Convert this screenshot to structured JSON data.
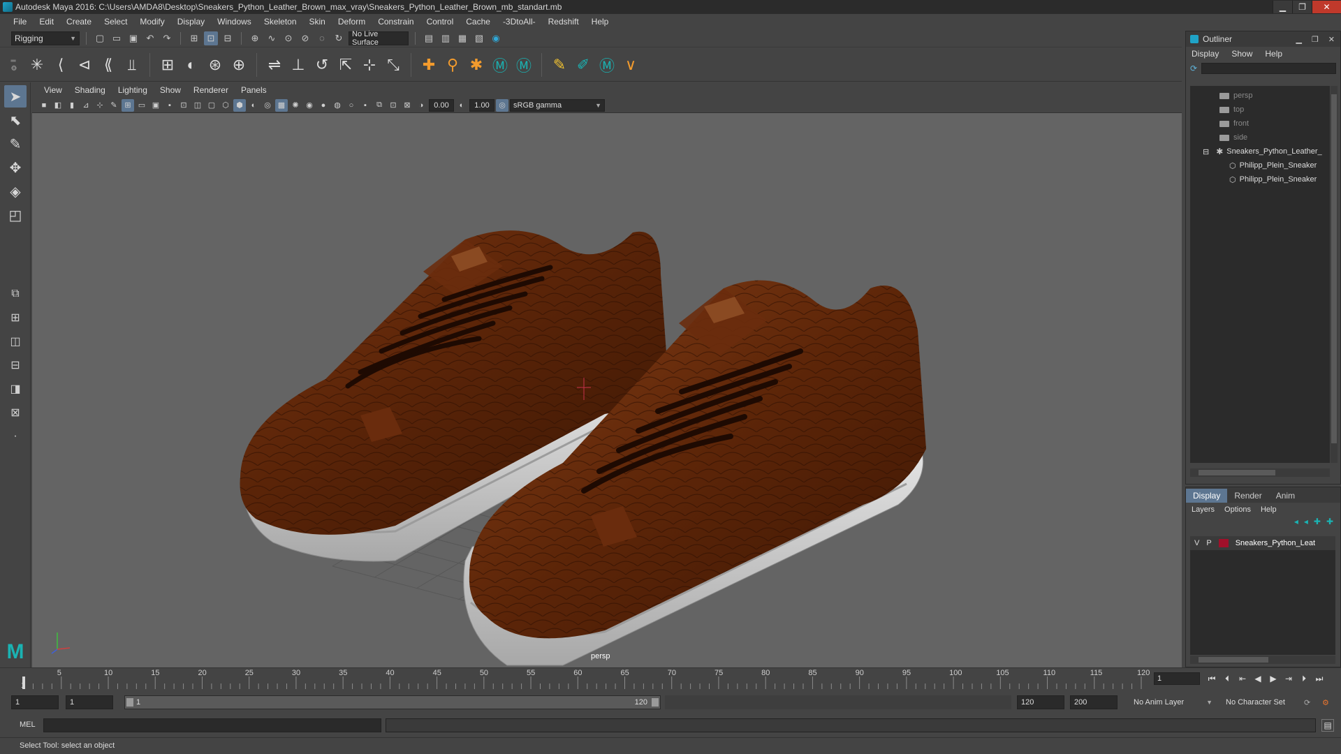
{
  "window": {
    "title": "Autodesk Maya 2016: C:\\Users\\AMDA8\\Desktop\\Sneakers_Python_Leather_Brown_max_vray\\Sneakers_Python_Leather_Brown_mb_standart.mb",
    "minimize": "▁",
    "restore": "❐",
    "close": "✕"
  },
  "main_menu": [
    "File",
    "Edit",
    "Create",
    "Select",
    "Modify",
    "Display",
    "Windows",
    "Skeleton",
    "Skin",
    "Deform",
    "Constrain",
    "Control",
    "Cache",
    "-3DtoAll-",
    "Redshift",
    "Help"
  ],
  "status_line": {
    "menu_set": "Rigging",
    "live_surface": "No Live Surface"
  },
  "viewport": {
    "menu": [
      "View",
      "Shading",
      "Lighting",
      "Show",
      "Renderer",
      "Panels"
    ],
    "exposure": "0.00",
    "gamma": "1.00",
    "color_space": "sRGB gamma",
    "camera": "persp"
  },
  "outliner": {
    "title": "Outliner",
    "menu": [
      "Display",
      "Show",
      "Help"
    ],
    "items": [
      {
        "label": "persp",
        "kind": "camera"
      },
      {
        "label": "top",
        "kind": "camera"
      },
      {
        "label": "front",
        "kind": "camera"
      },
      {
        "label": "side",
        "kind": "camera"
      },
      {
        "label": "Sneakers_Python_Leather_",
        "kind": "group"
      },
      {
        "label": "Philipp_Plein_Sneaker",
        "kind": "mesh"
      },
      {
        "label": "Philipp_Plein_Sneaker",
        "kind": "mesh"
      }
    ]
  },
  "layer_editor": {
    "tabs": [
      "Display",
      "Render",
      "Anim"
    ],
    "menu": [
      "Layers",
      "Options",
      "Help"
    ],
    "layer": {
      "visible": "V",
      "playback": "P",
      "name": "Sneakers_Python_Leat",
      "color": "#a0102a"
    }
  },
  "time_slider": {
    "ticks": [
      1,
      5,
      10,
      15,
      20,
      25,
      30,
      35,
      40,
      45,
      50,
      55,
      60,
      65,
      70,
      75,
      80,
      85,
      90,
      95,
      100,
      105,
      110,
      115,
      120
    ],
    "current_frame": "1",
    "start": 1,
    "end": 120
  },
  "range_slider": {
    "start_time": "1",
    "range_start": "1",
    "range_start_label": "1",
    "range_end_label": "120",
    "range_end": "120",
    "end_time": "200",
    "anim_layer": "No Anim Layer",
    "character_set": "No Character Set"
  },
  "command_line": {
    "label": "MEL"
  },
  "help_line": {
    "text": "Select Tool: select an object"
  }
}
